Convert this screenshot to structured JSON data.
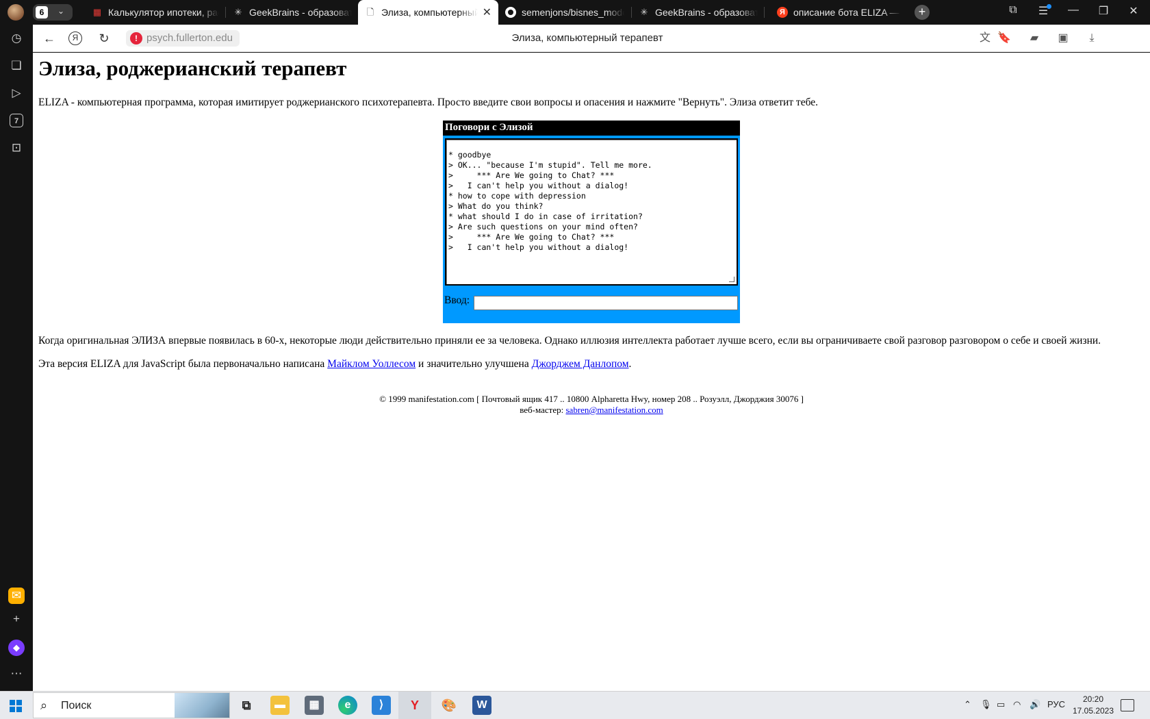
{
  "browser": {
    "tab_count": "6",
    "tabs": [
      {
        "label": "Калькулятор ипотеки, рас",
        "icon": "calculator-icon"
      },
      {
        "label": "GeekBrains - образовател",
        "icon": "openai-icon"
      },
      {
        "label": "Элиза, компьютерный",
        "icon": "document-icon",
        "active": true
      },
      {
        "label": "semenjons/bisnes_modeli",
        "icon": "github-icon"
      },
      {
        "label": "GeekBrains - образовател",
        "icon": "openai-icon"
      },
      {
        "label": "описание бота ELIZA — Ян",
        "icon": "yandex-icon"
      }
    ],
    "url": "psych.fullerton.edu",
    "page_title": "Элиза, компьютерный терапевт"
  },
  "page": {
    "heading": "Элиза, роджерианский терапевт",
    "intro": "ELIZA - компьютерная программа, которая имитирует роджерианского психотерапевта. Просто введите свои вопросы и опасения и нажмите \"Вернуть\". Элиза ответит тебе.",
    "chat": {
      "header": "Поговори с Элизой",
      "log": "* goodbye\n> OK... \"because I'm stupid\". Tell me more.\n>     *** Are We going to Chat? ***\n>   I can't help you without a dialog!\n* how to cope with depression\n> What do you think?\n* what should I do in case of irritation?\n> Are such questions on your mind often?\n>     *** Are We going to Chat? ***\n>   I can't help you without a dialog!",
      "input_label": "Ввод:",
      "input_value": ""
    },
    "history_paragraph": "Когда оригинальная ЭЛИЗА впервые появилась в 60-х, некоторые люди действительно приняли ее за человека. Однако иллюзия интеллекта работает лучше всего, если вы ограничиваете свой разговор разговором о себе и своей жизни.",
    "credits": {
      "prefix": "Эта версия ELIZA для JavaScript была первоначально написана",
      "author1": "Майклом Уоллесом",
      "middle": "и значительно улучшена",
      "author2": "Джорджем Данлопом",
      "suffix": "."
    },
    "footer": {
      "line1": "© 1999 manifestation.com [ Почтовый ящик 417 .. 10800 Alpharetta Hwy, номер 208 .. Розуэлл, Джорджия 30076 ]",
      "webmaster_label": "веб-мастер:",
      "webmaster_email": "sabren@manifestation.com"
    }
  },
  "sidebar": {
    "tab_count_badge": "7"
  },
  "taskbar": {
    "search_placeholder": "Поиск",
    "language": "РУС",
    "time": "20:20",
    "date": "17.05.2023"
  },
  "colors": {
    "chat_background": "#0099ff",
    "chat_header": "#000000",
    "link": "#0000ee",
    "warning": "#e5243b"
  }
}
